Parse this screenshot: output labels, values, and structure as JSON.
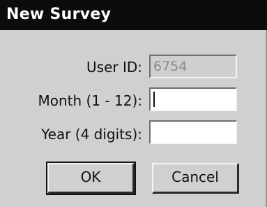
{
  "window": {
    "title": "New Survey"
  },
  "form": {
    "user_id": {
      "label": "User ID:",
      "value": "6754"
    },
    "month": {
      "label": "Month (1 - 12):",
      "value": ""
    },
    "year": {
      "label": "Year (4 digits):",
      "value": ""
    }
  },
  "buttons": {
    "ok_label": "OK",
    "cancel_label": "Cancel"
  },
  "colors": {
    "titlebar_bg": "#0c0c0c",
    "dialog_bg": "#d0d0d0",
    "field_bg": "#ffffff"
  }
}
